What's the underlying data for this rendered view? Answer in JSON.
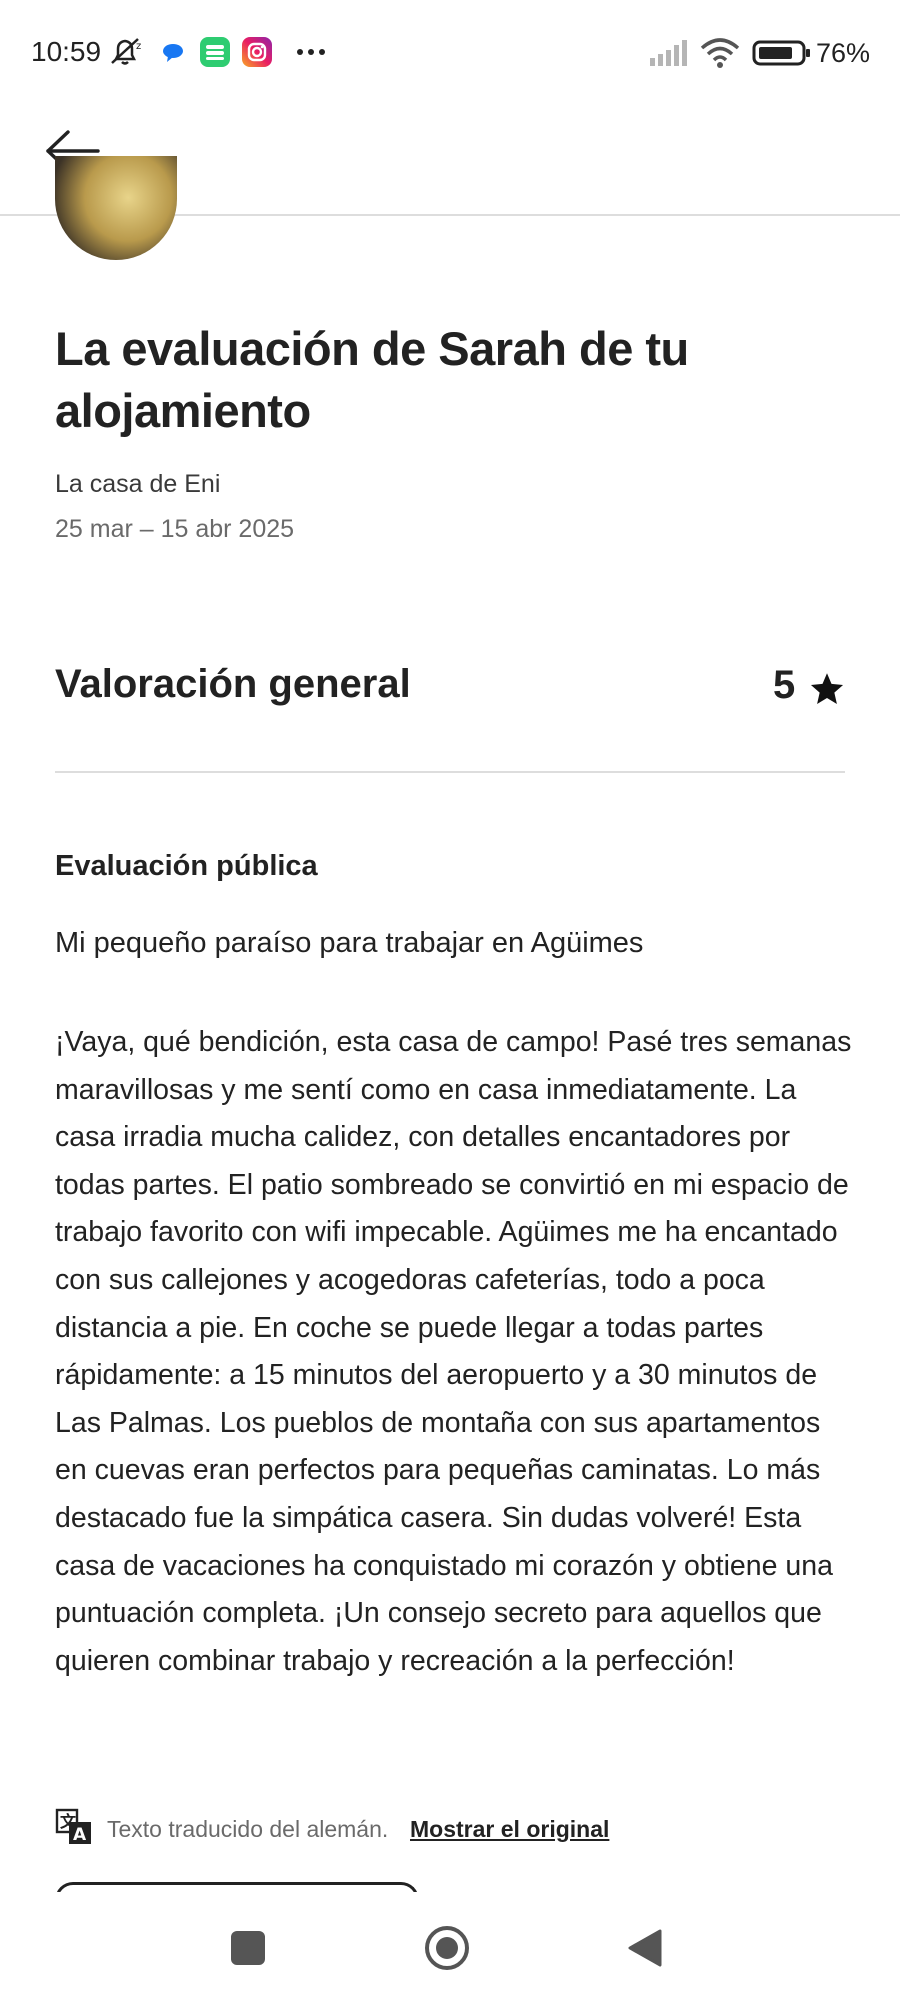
{
  "status_bar": {
    "time": "10:59",
    "battery": "76%",
    "notification_icons": [
      "mute-bell-icon",
      "chat-bubble-icon",
      "green-app-icon",
      "instagram-icon",
      "more-dots-icon"
    ],
    "system_icons": [
      "signal-icon",
      "wifi-icon",
      "battery-icon"
    ]
  },
  "header": {
    "back_icon": "arrow-left-icon"
  },
  "review": {
    "title": "La evaluación de Sarah de tu alojamiento",
    "listing": "La casa de Eni",
    "dates": "25 mar – 15 abr 2025",
    "overall_label": "Valoración general",
    "overall_rating": "5",
    "public_heading": "Evaluación pública",
    "headline": "Mi pequeño paraíso para trabajar en Agüimes",
    "body": "¡Vaya, qué bendición, esta casa de campo! Pasé tres semanas maravillosas y me sentí como en casa inmediatamente. La casa irradia mucha calidez, con detalles encantadores por todas partes. El patio sombreado se convirtió en mi espacio de trabajo favorito con wifi impecable. Agüimes me ha encantado con sus callejones y acogedoras cafeterías, todo a poca distancia a pie. En coche se puede llegar a todas partes rápidamente: a 15 minutos del aeropuerto y a 30 minutos de Las Palmas. Los pueblos de montaña con sus apartamentos en cuevas eran perfectos para pequeñas caminatas. Lo más destacado fue la simpática casera. Sin dudas volveré! Esta casa de vacaciones ha conquistado mi corazón y obtiene una puntuación completa. ¡Un consejo secreto para aquellos que quieren combinar trabajo y recreación a la perfección!",
    "translation_note": "Texto traducido del alemán.",
    "show_original": "Mostrar el original"
  },
  "colors": {
    "text": "#222222",
    "muted": "#6a6a6a",
    "divider": "#dddddd",
    "background": "#ffffff"
  }
}
